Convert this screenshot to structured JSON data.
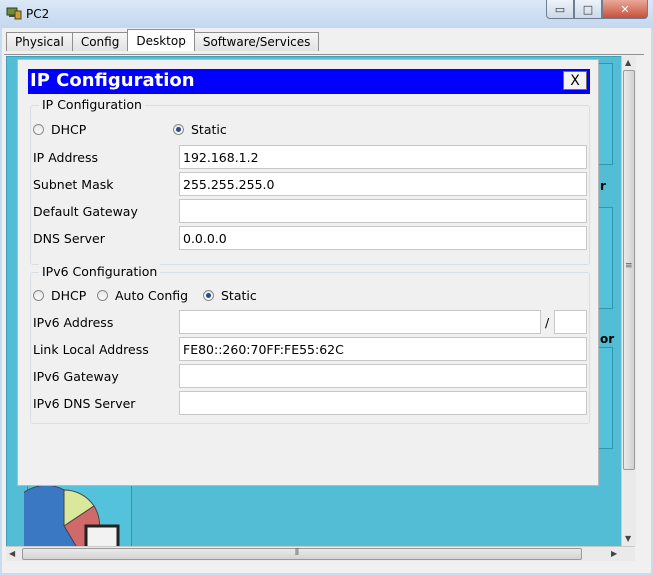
{
  "window": {
    "title": "PC2",
    "minimize_glyph": "▭",
    "maximize_glyph": "□",
    "close_glyph": "✕"
  },
  "tabs": [
    {
      "label": "Physical"
    },
    {
      "label": "Config"
    },
    {
      "label": "Desktop",
      "active": true
    },
    {
      "label": "Software/Services"
    }
  ],
  "desktop": {
    "frag_text_1": "r",
    "frag_text_2": "or"
  },
  "dialog": {
    "title": "IP Configuration",
    "close_label": "X",
    "ipv4": {
      "legend": "IP Configuration",
      "dhcp_label": "DHCP",
      "static_label": "Static",
      "selected": "static",
      "fields": [
        {
          "label": "IP Address",
          "value": "192.168.1.2"
        },
        {
          "label": "Subnet Mask",
          "value": "255.255.255.0"
        },
        {
          "label": "Default Gateway",
          "value": ""
        },
        {
          "label": "DNS Server",
          "value": "0.0.0.0"
        }
      ]
    },
    "ipv6": {
      "legend": "IPv6 Configuration",
      "dhcp_label": "DHCP",
      "auto_label": "Auto Config",
      "static_label": "Static",
      "selected": "static",
      "prefix_separator": "/",
      "fields": [
        {
          "label": "IPv6 Address",
          "value": "",
          "prefix": ""
        },
        {
          "label": "Link Local Address",
          "value": "FE80::260:70FF:FE55:62C"
        },
        {
          "label": "IPv6 Gateway",
          "value": ""
        },
        {
          "label": "IPv6 DNS Server",
          "value": ""
        }
      ]
    }
  },
  "scrollbar": {
    "grip_glyph": "≡",
    "hgrip_glyph": "⦀"
  },
  "colors": {
    "title_bar": "#0000ff",
    "desktop_bg": "#53bdd6"
  },
  "icons": [
    "app-icon",
    "pie-chart-icon"
  ]
}
